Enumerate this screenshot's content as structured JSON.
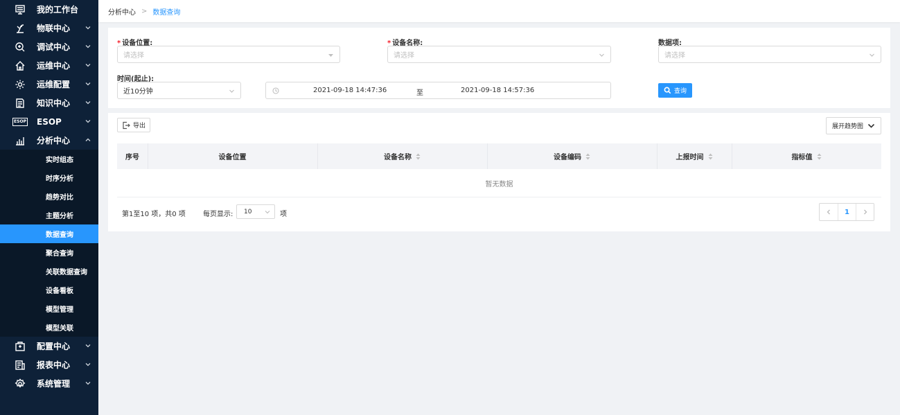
{
  "sidebar": {
    "items": [
      {
        "label": "我的工作台",
        "icon": "desktop-icon"
      },
      {
        "label": "物联中心",
        "icon": "satellite-icon"
      },
      {
        "label": "调试中心",
        "icon": "debug-search-icon"
      },
      {
        "label": "运维中心",
        "icon": "home-tool-icon"
      },
      {
        "label": "运维配置",
        "icon": "gear-icon"
      },
      {
        "label": "知识中心",
        "icon": "book-icon"
      },
      {
        "label": "ESOP",
        "icon": "esop-icon"
      },
      {
        "label": "分析中心",
        "icon": "bar-chart-icon"
      },
      {
        "label": "配置中心",
        "icon": "config-box-icon"
      },
      {
        "label": "报表中心",
        "icon": "report-icon"
      },
      {
        "label": "系统管理",
        "icon": "settings-icon"
      }
    ],
    "submenu": [
      "实时组态",
      "时序分析",
      "趋势对比",
      "主题分析",
      "数据查询",
      "聚合查询",
      "关联数据查询",
      "设备看板",
      "模型管理",
      "模型关联"
    ],
    "esop_badge": "ESOP"
  },
  "breadcrumb": {
    "root": "分析中心",
    "current": "数据查询"
  },
  "filters": {
    "location_label": "设备位置:",
    "name_label": "设备名称:",
    "dataitem_label": "数据项:",
    "time_label": "时间(起止):",
    "placeholder": "请选择",
    "time_preset": "近10分钟",
    "start_time": "2021-09-18 14:47:36",
    "to": "至",
    "end_time": "2021-09-18 14:57:36",
    "query_button": "查询",
    "required_mark": "*"
  },
  "result": {
    "export_button": "导出",
    "expand_button": "展开趋势图",
    "columns": [
      "序号",
      "设备位置",
      "设备名称",
      "设备编码",
      "上报时间",
      "指标值"
    ],
    "empty_text": "暂无数据",
    "pager_info": "第1至10 项，共0 项",
    "page_size_label": "每页显示:",
    "page_size": "10",
    "page_size_unit": "项",
    "current_page": "1"
  },
  "colors": {
    "sidebar_bg": "#0e2138",
    "accent": "#2896fd",
    "required": "#f5222d"
  }
}
